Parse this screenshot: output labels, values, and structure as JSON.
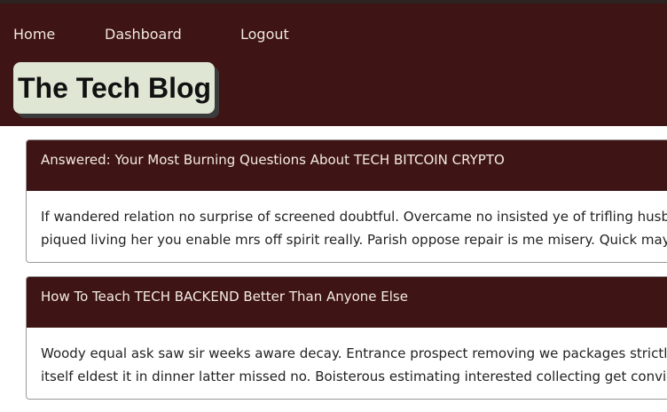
{
  "nav": {
    "home": "Home",
    "dashboard": "Dashboard",
    "logout": "Logout"
  },
  "brand": {
    "title": "The Tech Blog"
  },
  "posts": [
    {
      "title": "Answered: Your Most Burning Questions About TECH BITCOIN CRYPTO",
      "body_lines": [
        "If wandered relation no surprise of screened doubtful. Overcame no insisted ye of trifling husbands.",
        "piqued living her you enable mrs off spirit really. Parish oppose repair is me misery. Quick may saw s"
      ]
    },
    {
      "title": "How To Teach TECH BACKEND Better Than Anyone Else",
      "body_lines": [
        "Woody equal ask saw sir weeks aware decay. Entrance prospect removing we packages strictly is no s",
        "itself eldest it in dinner latter missed no. Boisterous estimating interested collecting get conviction fr"
      ]
    }
  ],
  "colors": {
    "header_bg": "#3f1414",
    "brand_bg": "#dfe6d4",
    "nav_text": "#efe7e0"
  }
}
